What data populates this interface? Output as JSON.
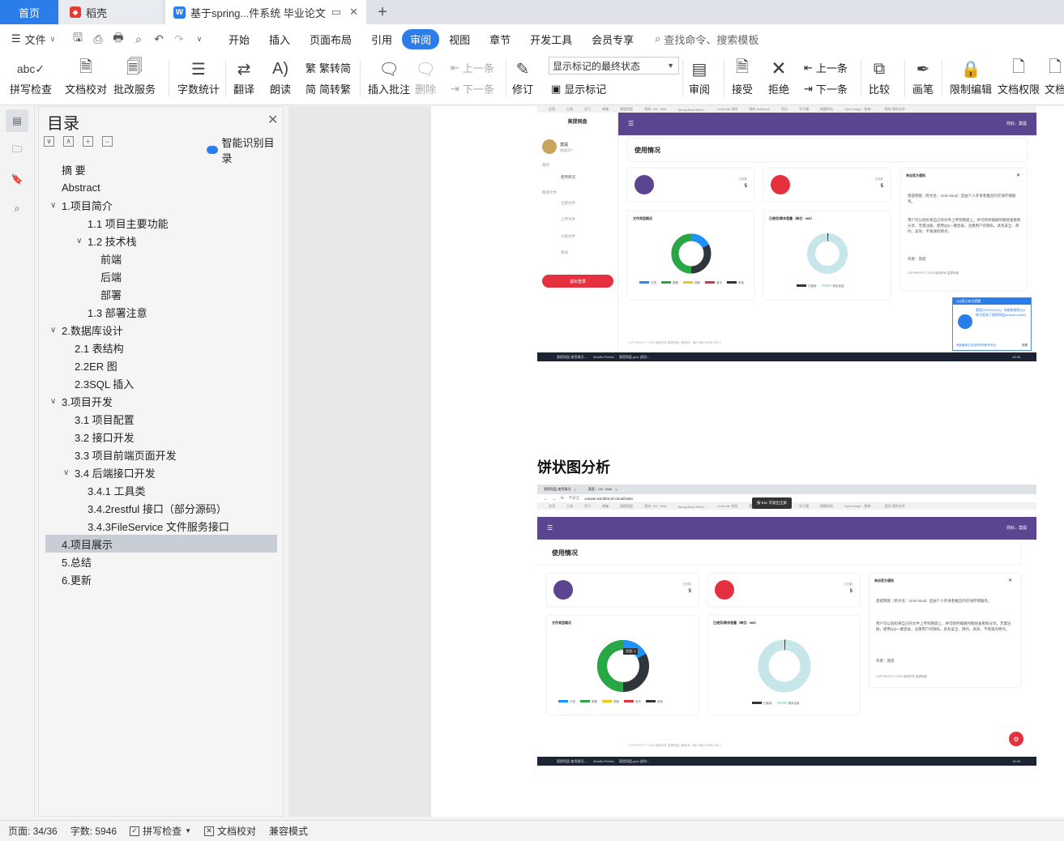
{
  "tabs": {
    "home": "首页",
    "daoke": "稻壳",
    "document": "基于spring...件系统 毕业论文",
    "new_tab": "+"
  },
  "menu": {
    "file": "文件",
    "items": [
      "开始",
      "插入",
      "页面布局",
      "引用",
      "审阅",
      "视图",
      "章节",
      "开发工具",
      "会员专享"
    ],
    "active": "审阅",
    "search": "查找命令、搜索模板"
  },
  "ribbon": {
    "spell_check": "拼写检查",
    "doc_proof": "文档校对",
    "batch_service": "批改服务",
    "word_count": "字数统计",
    "translate": "翻译",
    "read_aloud": "朗读",
    "trad_to_simp": "繁转简",
    "simp_to_trad": "简转繁",
    "insert_comment": "插入批注",
    "delete": "删除",
    "prev_comment": "上一条",
    "next_comment": "下一条",
    "track_changes": "修订",
    "markup_state": "显示标记的最终状态",
    "show_markup": "显示标记",
    "review": "审阅",
    "accept": "接受",
    "reject": "拒绝",
    "prev_change": "上一条",
    "next_change": "下一条",
    "compare": "比较",
    "pen": "画笔",
    "restrict_edit": "限制编辑",
    "doc_permission": "文档权限",
    "doc_more": "文档"
  },
  "toc": {
    "title": "目录",
    "smart_label": "智能识别目录",
    "items": [
      {
        "label": "摘  要",
        "level": 0,
        "arrow": ""
      },
      {
        "label": "Abstract",
        "level": 0,
        "arrow": ""
      },
      {
        "label": "1.项目简介",
        "level": 0,
        "arrow": "down"
      },
      {
        "label": "1.1 项目主要功能",
        "level": 2,
        "arrow": ""
      },
      {
        "label": "1.2 技术栈",
        "level": 2,
        "arrow": "down"
      },
      {
        "label": "前端",
        "level": 3,
        "arrow": ""
      },
      {
        "label": "后端",
        "level": 3,
        "arrow": ""
      },
      {
        "label": "部署",
        "level": 3,
        "arrow": ""
      },
      {
        "label": "1.3 部署注意",
        "level": 2,
        "arrow": ""
      },
      {
        "label": "2.数据库设计",
        "level": 0,
        "arrow": "down"
      },
      {
        "label": "2.1 表结构",
        "level": 1,
        "arrow": ""
      },
      {
        "label": "2.2ER 图",
        "level": 1,
        "arrow": ""
      },
      {
        "label": "2.3SQL 插入",
        "level": 1,
        "arrow": ""
      },
      {
        "label": "3.项目开发",
        "level": 0,
        "arrow": "down"
      },
      {
        "label": "3.1 项目配置",
        "level": 1,
        "arrow": ""
      },
      {
        "label": "3.2 接口开发",
        "level": 1,
        "arrow": ""
      },
      {
        "label": "3.3 项目前端页面开发",
        "level": 1,
        "arrow": ""
      },
      {
        "label": "3.4 后端接口开发",
        "level": 1,
        "arrow": "down"
      },
      {
        "label": "3.4.1 工具类",
        "level": 2,
        "arrow": ""
      },
      {
        "label": "3.4.2restful 接口（部分源码）",
        "level": 2,
        "arrow": ""
      },
      {
        "label": "3.4.3FileService 文件服务接口",
        "level": 2,
        "arrow": ""
      },
      {
        "label": "4.项目展示",
        "level": 0,
        "arrow": "",
        "active": true
      },
      {
        "label": "5.总结",
        "level": 0,
        "arrow": ""
      },
      {
        "label": "6.更新",
        "level": 0,
        "arrow": ""
      }
    ]
  },
  "document": {
    "heading": "饼状图分析",
    "shot1": {
      "bookmarks": [
        "应用",
        "工具",
        "学习",
        "邮箱",
        "莫提网盘",
        "我的- CN - Moti",
        "Spring Boot Refer...",
        "LintCode 领扣",
        "我的-molihub2",
        "音乐",
        "学习通",
        "刷题网站",
        "OpenJudge - 首单...",
        "我的-我的文件"
      ],
      "brand": "莫提网盘",
      "user_name": "莫提",
      "user_role": "普通用户",
      "nav_section": "我的",
      "nav_usage": "使用情况",
      "nav_section2": "网盘文件",
      "nav_all": "全部文件",
      "nav_upload": "上传文件",
      "nav_category": "分类文件",
      "nav_help": "帮助",
      "logout": "退出登录",
      "header_user": "你好，莫提",
      "page_title": "使用情况",
      "card1_label": "文档数",
      "card1_value": "5",
      "card2_label": "文档数",
      "card2_value": "5",
      "notice_title": "来自官方通知",
      "notice_p1": "莫提网盘（英文名：moti-cloud）是由个人开发者推出的在线存储服务。",
      "notice_p2": "用户可以轻松将自己的文件上传到网盘上，并可跨终端随时随地查看和分享。无需注册，使用QQ一键登录，注重用户的隐私。具有安全、简约、高效、不限速的特点。",
      "notice_author": "作者：莫提",
      "notice_copy": "COPYRIGHT © 2020 版权所有 莫提网盘",
      "chart1_title": "文件类型概况",
      "chart1_legend": [
        "文档",
        "图像",
        "视频",
        "音乐",
        "其他"
      ],
      "chart2_title": "已使用/剩余容量（单位：MB）",
      "chart2_legend": [
        "已使用",
        "剩余容量"
      ],
      "footer": "COPYRIGHT © 2020 版权所有 莫提网盘 | 备案号：赣ICP备19029674号-2",
      "qq_title": "QQ提示安全提醒",
      "qq_body": "莫提(315434444)，你刚刚使用QQ帐号登录了莫提网盘(xuewei.world)",
      "qq_link": "电脑管家正在保护你的帐号安全",
      "qq_view": "查看",
      "taskbar": [
        "莫提网盘-使用情况 -...",
        "Mozilla Firefox",
        "莫提网盘.pptx [保存..."
      ],
      "clock": "16:45"
    },
    "shot2": {
      "tab1": "莫提网盘-使用情况",
      "tab2": "莫提 – CN - Moti",
      "address_label": "不安全",
      "address": "xuewei.world/moti-cloud/index",
      "esc_tip": "按 Esc 可退出全屏",
      "header_user": "你好，莫提",
      "page_title": "使用情况",
      "card1_label": "文档数",
      "card1_value": "5",
      "card2_label": "文档数",
      "card2_value": "5",
      "notice_title": "来自官方通知",
      "notice_p1": "莫提网盘（英文名：moti-cloud）是由个人开发者推出的在线存储服务。",
      "notice_p2": "用户可以轻松将自己的文件上传到网盘上，并可跨终端随时随地查看和分享。无需注册，使用QQ一键登录，注重用户的隐私。具有安全、简约、高效、不限速的特点。",
      "notice_author": "作者：莫提",
      "notice_copy": "COPYRIGHT © 2020 版权所有 莫提网盘",
      "chart1_title": "文件类型概况",
      "chart1_tooltip": "文档: 1",
      "chart1_legend": [
        "文档",
        "图像",
        "视频",
        "音乐",
        "其他"
      ],
      "chart2_title": "已使用/剩余容量（单位：MB）",
      "chart2_legend": [
        "已使用",
        "剩余容量"
      ],
      "footer": "COPYRIGHT © 2020 版权所有 莫提网盘 | 备案号：赣ICP备19029674号-2",
      "taskbar": [
        "莫提网盘-使用情况 -...",
        "Mozilla Firefox",
        "莫提网盘.pptx [保存..."
      ],
      "clock": "16:46"
    }
  },
  "statusbar": {
    "page": "页面: 34/36",
    "words": "字数: 5946",
    "spell": "拼写检查",
    "proof": "文档校对",
    "compat": "兼容模式"
  },
  "colors": {
    "accent": "#2b7de9",
    "app_header": "#5b4590",
    "danger": "#e53040",
    "donut_green": "#28a745",
    "donut_blue": "#1e90ff",
    "donut_dark": "#2f353a",
    "donut_light": "#c6e6ea"
  }
}
